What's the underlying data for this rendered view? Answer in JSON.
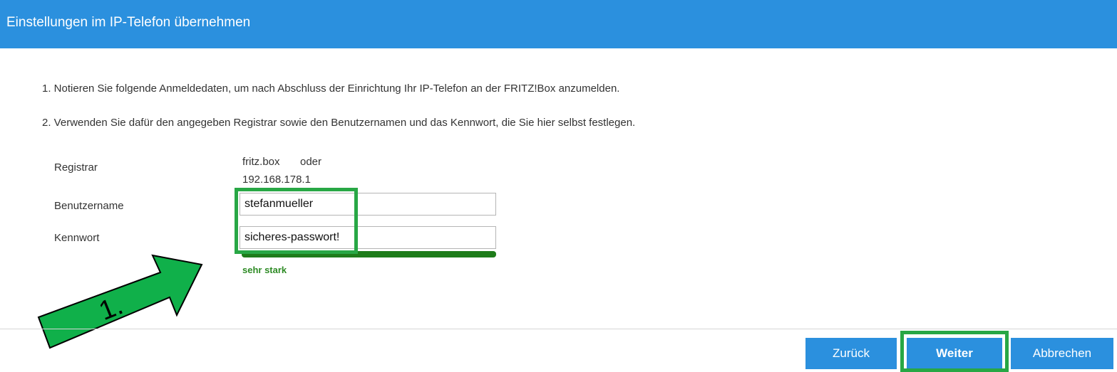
{
  "header": {
    "title": "Einstellungen im IP-Telefon übernehmen"
  },
  "instructions": [
    "1. Notieren Sie folgende Anmeldedaten, um nach Abschluss der Einrichtung Ihr IP-Telefon an der FRITZ!Box anzumelden.",
    "2. Verwenden Sie dafür den angegeben Registrar sowie den Benutzernamen und das Kennwort, die Sie hier selbst festlegen."
  ],
  "form": {
    "registrar_label": "Registrar",
    "registrar_value_1": "fritz.box",
    "registrar_or": "oder",
    "registrar_value_2": "192.168.178.1",
    "username_label": "Benutzername",
    "username_value": "stefanmueller",
    "password_label": "Kennwort",
    "password_value": "sicheres-passwort!",
    "password_strength_label": "sehr stark",
    "password_strength": 1.0
  },
  "annotation": {
    "arrow_label": "1.",
    "highlight_color": "#28a745"
  },
  "buttons": {
    "back": "Zurück",
    "next": "Weiter",
    "cancel": "Abbrechen"
  },
  "colors": {
    "accent": "#2b90de",
    "strength_bar": "#1e7c1a",
    "strength_text": "#2e8b25"
  }
}
